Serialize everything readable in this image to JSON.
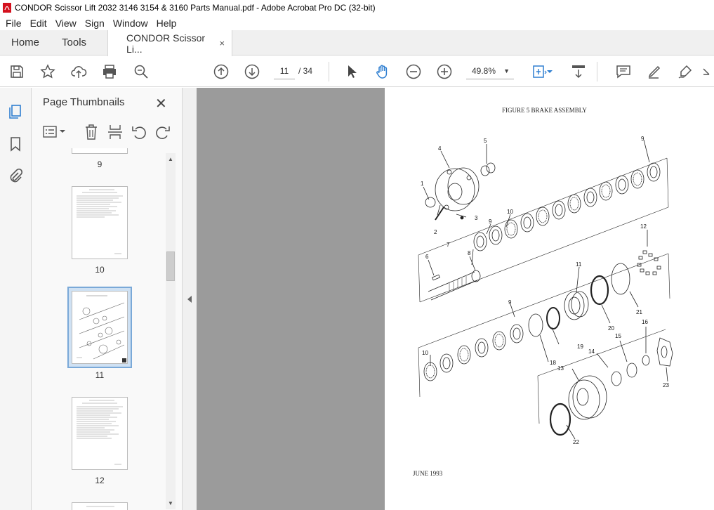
{
  "window": {
    "title": "CONDOR Scissor Lift 2032 3146 3154 & 3160 Parts Manual.pdf - Adobe Acrobat Pro DC (32-bit)"
  },
  "menu": [
    "File",
    "Edit",
    "View",
    "Sign",
    "Window",
    "Help"
  ],
  "tabs": {
    "home": "Home",
    "tools": "Tools",
    "document": "CONDOR Scissor Li...",
    "close": "×"
  },
  "toolbar": {
    "current_page": "11",
    "page_total": "/ 34",
    "zoom": "49.8%"
  },
  "panel": {
    "title": "Page Thumbnails",
    "thumbnails": [
      {
        "label": "9"
      },
      {
        "label": "10"
      },
      {
        "label": "11",
        "selected": true
      },
      {
        "label": "12"
      }
    ]
  },
  "page": {
    "figure_title": "FIGURE 5  BRAKE ASSEMBLY",
    "footer": "JUNE 1993",
    "callouts": [
      "1",
      "2",
      "3",
      "4",
      "5",
      "9",
      "10",
      "9",
      "6",
      "7",
      "8",
      "12",
      "11",
      "21",
      "20",
      "9",
      "19",
      "18",
      "10",
      "14",
      "15",
      "16",
      "13",
      "23",
      "22"
    ]
  },
  "colors": {
    "accent": "#2f7fd1",
    "viewer_bg": "#9b9b9b",
    "pdf_red": "#d4111e"
  }
}
